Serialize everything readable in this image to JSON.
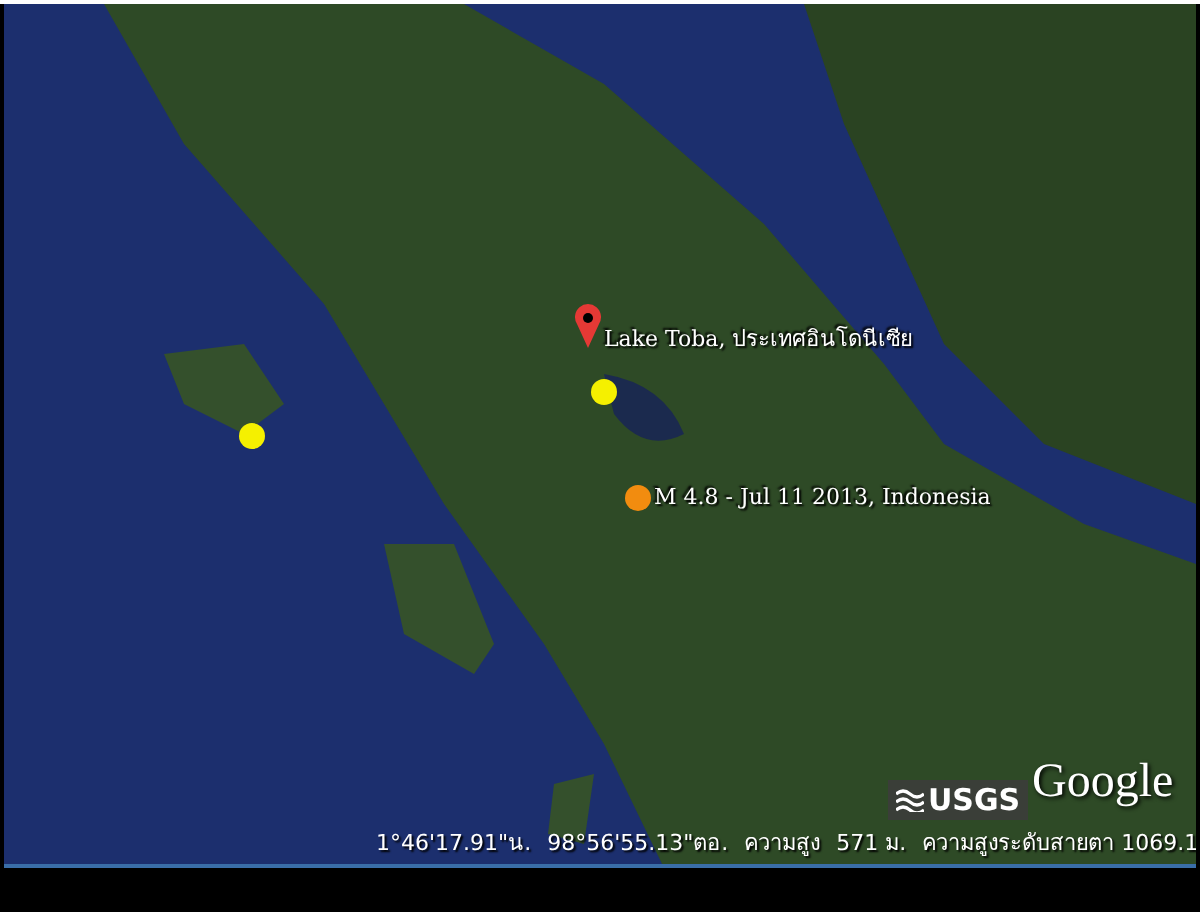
{
  "placemarks": [
    {
      "kind": "pin",
      "label": "Lake Toba, ประเทศอินโดนีเซีย",
      "color": "#e53935"
    },
    {
      "kind": "dot",
      "color": "#f5f000"
    },
    {
      "kind": "dot",
      "color": "#f5f000"
    },
    {
      "kind": "dot",
      "label": "M 4.8 - Jul 11 2013, Indonesia",
      "color": "#f28c0f"
    }
  ],
  "logos": {
    "usgs": "USGS",
    "google": "Google"
  },
  "status_bar": {
    "latitude": "1°46'17.91\"น.",
    "longitude": "98°56'55.13\"ตอ.",
    "elevation_label": "ความสูง",
    "elevation": "571 ม.",
    "eye_altitude": "ความสูงระดับสายตา 1069.1"
  }
}
